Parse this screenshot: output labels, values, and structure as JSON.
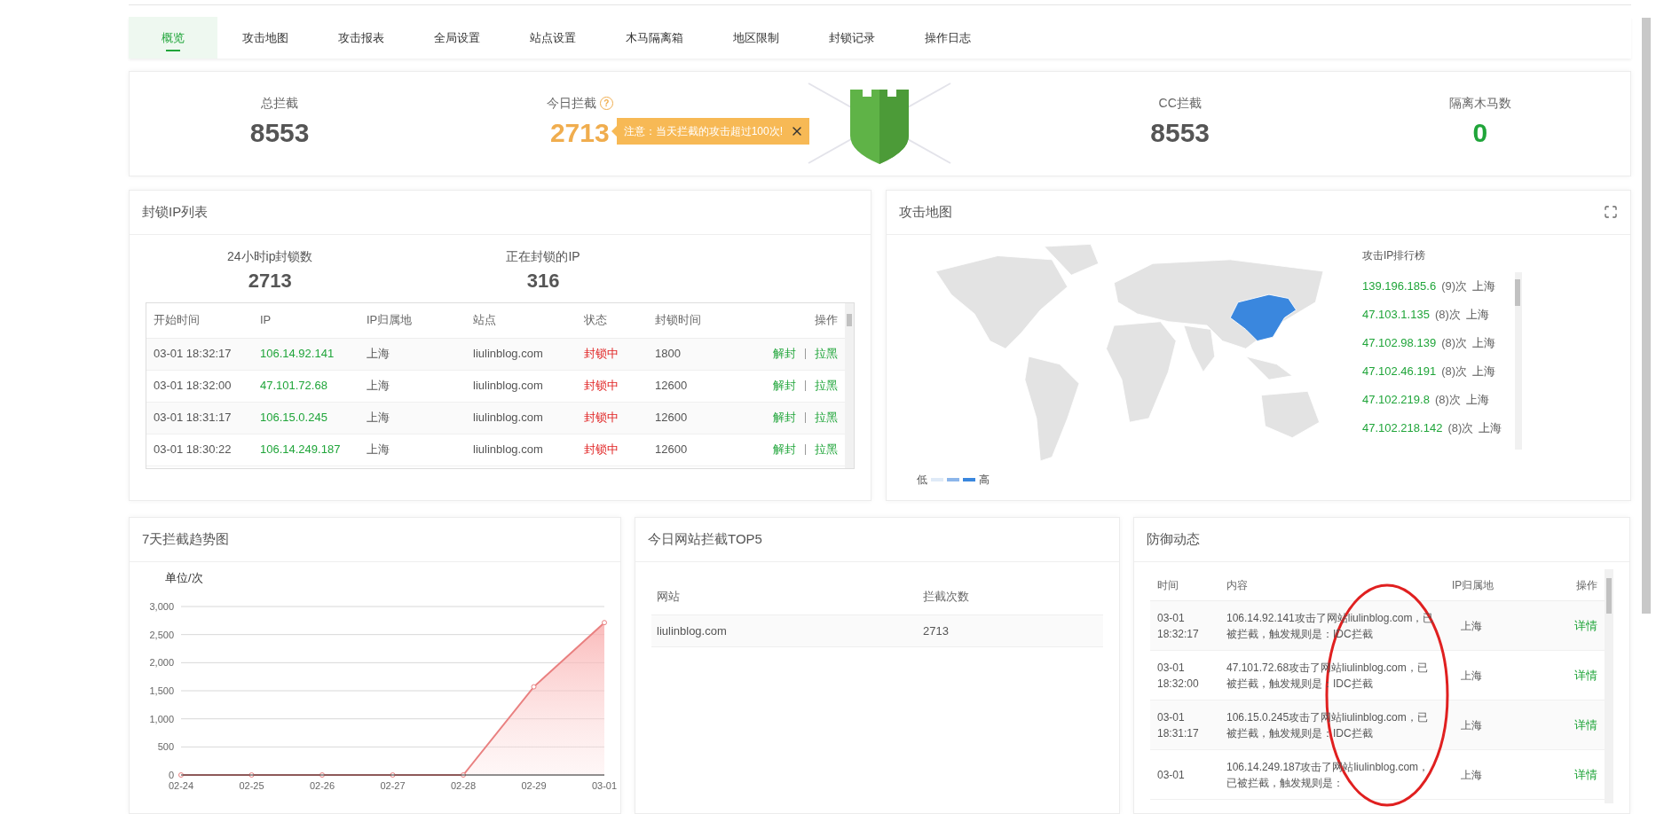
{
  "tabs": [
    {
      "label": "概览",
      "selected": true
    },
    {
      "label": "攻击地图",
      "selected": false
    },
    {
      "label": "攻击报表",
      "selected": false
    },
    {
      "label": "全局设置",
      "selected": false
    },
    {
      "label": "站点设置",
      "selected": false
    },
    {
      "label": "木马隔离箱",
      "selected": false
    },
    {
      "label": "地区限制",
      "selected": false
    },
    {
      "label": "封锁记录",
      "selected": false
    },
    {
      "label": "操作日志",
      "selected": false
    }
  ],
  "stats": [
    {
      "label": "总拦截",
      "value": "8553",
      "color": "#555555"
    },
    {
      "label": "今日拦截",
      "value": "2713",
      "color": "#f0ad4e",
      "help": "?"
    },
    {
      "label": "CC拦截",
      "value": "8553",
      "color": "#555555"
    },
    {
      "label": "隔离木马数",
      "value": "0",
      "color": "#20a53a"
    }
  ],
  "notice": {
    "text": "注意：当天拦截的攻击超过100次!"
  },
  "blocked_ip": {
    "title": "封锁IP列表",
    "summary": [
      {
        "label": "24小时ip封锁数",
        "value": "2713"
      },
      {
        "label": "正在封锁的IP",
        "value": "316"
      }
    ],
    "columns": [
      "开始时间",
      "IP",
      "IP归属地",
      "站点",
      "状态",
      "封锁时间",
      "操作"
    ],
    "rows": [
      {
        "start": "03-01 18:32:17",
        "ip": "106.14.92.141",
        "location": "上海",
        "site": "liulinblog.com",
        "status": "封锁中",
        "duration": "1800",
        "actions": [
          "解封",
          "拉黑"
        ]
      },
      {
        "start": "03-01 18:32:00",
        "ip": "47.101.72.68",
        "location": "上海",
        "site": "liulinblog.com",
        "status": "封锁中",
        "duration": "12600",
        "actions": [
          "解封",
          "拉黑"
        ]
      },
      {
        "start": "03-01 18:31:17",
        "ip": "106.15.0.245",
        "location": "上海",
        "site": "liulinblog.com",
        "status": "封锁中",
        "duration": "12600",
        "actions": [
          "解封",
          "拉黑"
        ]
      },
      {
        "start": "03-01 18:30:22",
        "ip": "106.14.249.187",
        "location": "上海",
        "site": "liulinblog.com",
        "status": "封锁中",
        "duration": "12600",
        "actions": [
          "解封",
          "拉黑"
        ]
      }
    ]
  },
  "attack_map": {
    "title": "攻击地图",
    "ranking_title": "攻击IP排行榜",
    "legend": {
      "low": "低",
      "high": "高"
    },
    "ranking": [
      {
        "ip": "139.196.185.6",
        "count": "(9)次",
        "location": "上海"
      },
      {
        "ip": "47.103.1.135",
        "count": "(8)次",
        "location": "上海"
      },
      {
        "ip": "47.102.98.139",
        "count": "(8)次",
        "location": "上海"
      },
      {
        "ip": "47.102.46.191",
        "count": "(8)次",
        "location": "上海"
      },
      {
        "ip": "47.102.219.8",
        "count": "(8)次",
        "location": "上海"
      },
      {
        "ip": "47.102.218.142",
        "count": "(8)次",
        "location": "上海"
      }
    ]
  },
  "trend": {
    "title": "7天拦截趋势图",
    "chart_data": {
      "type": "area",
      "ylabel": "单位/次",
      "categories": [
        "02-24",
        "02-25",
        "02-26",
        "02-27",
        "02-28",
        "02-29",
        "03-01"
      ],
      "values": [
        0,
        0,
        0,
        0,
        0,
        1570,
        2713
      ],
      "ylim": [
        0,
        3000
      ],
      "grid": true,
      "yticks": [
        {
          "value": 0,
          "label": "0"
        },
        {
          "value": 500,
          "label": "500"
        },
        {
          "value": 1000,
          "label": "1,000"
        },
        {
          "value": 1500,
          "label": "1,500"
        },
        {
          "value": 2000,
          "label": "2,000"
        },
        {
          "value": 2500,
          "label": "2,500"
        },
        {
          "value": 3000,
          "label": "3,000"
        }
      ]
    }
  },
  "top5": {
    "title": "今日网站拦截TOP5",
    "columns": [
      "网站",
      "拦截次数"
    ],
    "rows": [
      {
        "site": "liulinblog.com",
        "count": "2713"
      }
    ]
  },
  "defense": {
    "title": "防御动态",
    "columns": [
      "时间",
      "内容",
      "IP归属地",
      "操作"
    ],
    "rows": [
      {
        "time": "03-01 18:32:17",
        "content": "106.14.92.141攻击了网站liulinblog.com，已被拦截，触发规则是：IDC拦截",
        "location": "上海",
        "action": "详情"
      },
      {
        "time": "03-01 18:32:00",
        "content": "47.101.72.68攻击了网站liulinblog.com，已被拦截，触发规则是：IDC拦截",
        "location": "上海",
        "action": "详情"
      },
      {
        "time": "03-01 18:31:17",
        "content": "106.15.0.245攻击了网站liulinblog.com，已被拦截，触发规则是：IDC拦截",
        "location": "上海",
        "action": "详情"
      },
      {
        "time": "03-01",
        "content": "106.14.249.187攻击了网站liulinblog.com，已被拦截，触发规则是：",
        "location": "上海",
        "action": "详情"
      }
    ]
  }
}
